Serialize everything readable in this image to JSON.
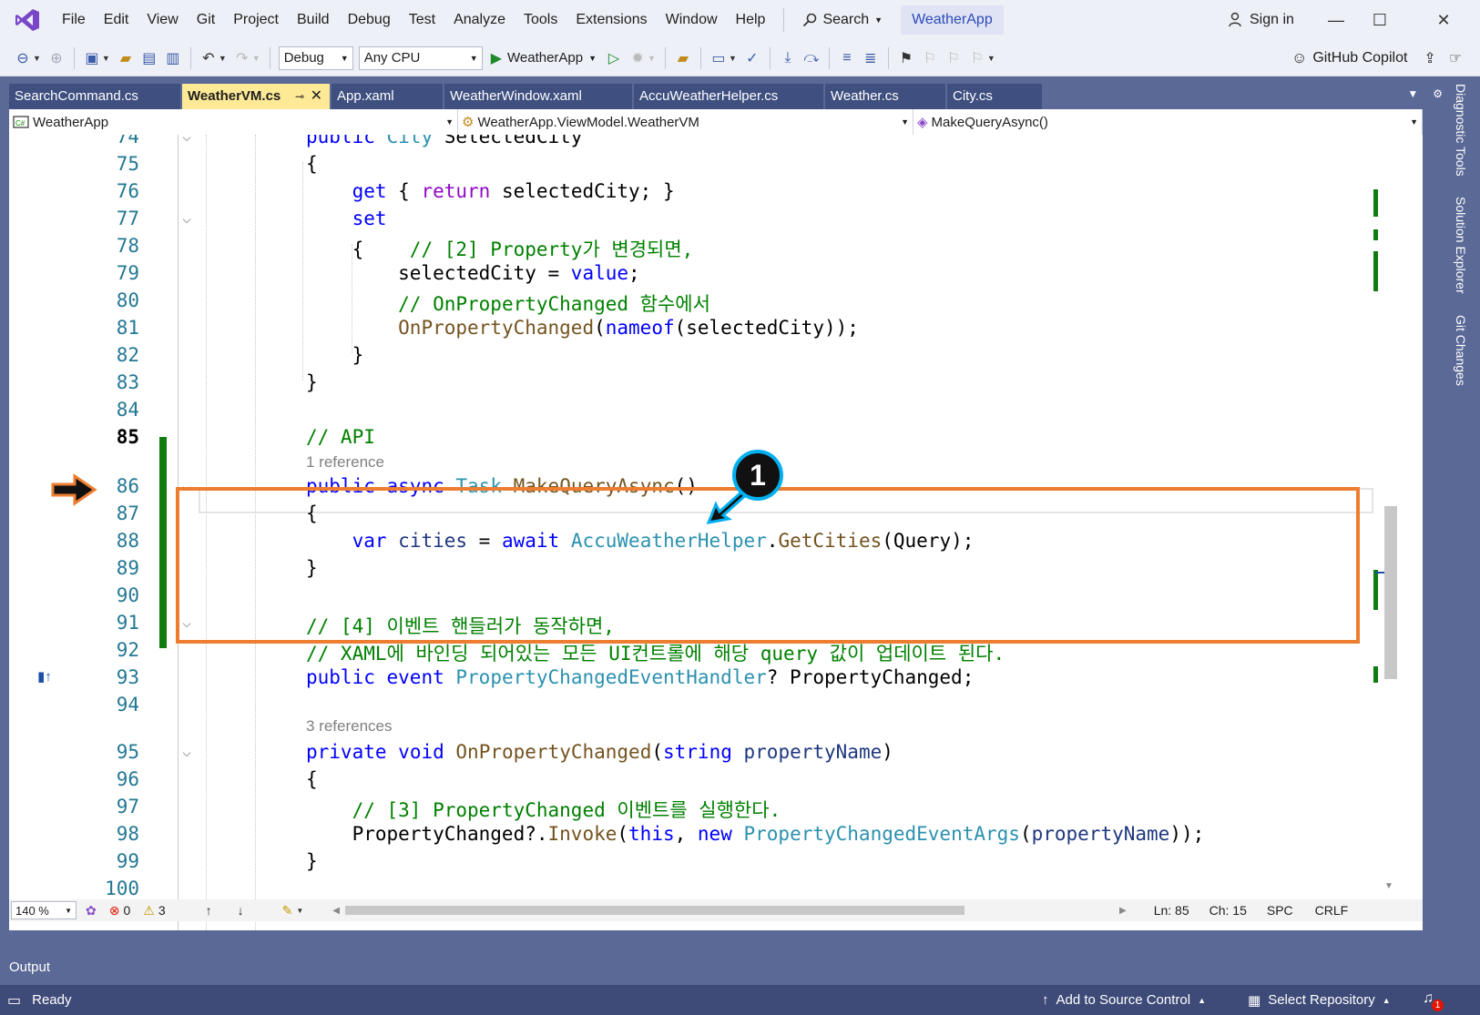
{
  "menu": {
    "items": [
      "File",
      "Edit",
      "View",
      "Git",
      "Project",
      "Build",
      "Debug",
      "Test",
      "Analyze",
      "Tools",
      "Extensions",
      "Window",
      "Help"
    ],
    "search_label": "Search",
    "solution_name": "WeatherApp",
    "sign_in": "Sign in"
  },
  "toolbar": {
    "config": "Debug",
    "platform": "Any CPU",
    "run_target": "WeatherApp",
    "copilot": "GitHub Copilot"
  },
  "tabs": [
    {
      "label": "SearchCommand.cs",
      "active": false
    },
    {
      "label": "WeatherVM.cs",
      "active": true
    },
    {
      "label": "App.xaml",
      "active": false
    },
    {
      "label": "WeatherWindow.xaml",
      "active": false
    },
    {
      "label": "AccuWeatherHelper.cs",
      "active": false
    },
    {
      "label": "Weather.cs",
      "active": false
    },
    {
      "label": "City.cs",
      "active": false
    }
  ],
  "navbar": {
    "project": "WeatherApp",
    "type": "WeatherApp.ViewModel.WeatherVM",
    "member": "MakeQueryAsync()"
  },
  "editor": {
    "line_numbers": [
      "74",
      "75",
      "76",
      "77",
      "78",
      "79",
      "80",
      "81",
      "82",
      "83",
      "84",
      "85",
      "86",
      "87",
      "88",
      "89",
      "90",
      "91",
      "92",
      "93",
      "94",
      "95",
      "96",
      "97",
      "98",
      "99",
      "100"
    ],
    "current_line": "85",
    "codelens_1": "1 reference",
    "codelens_2": "3 references",
    "annotation_badge": "1"
  },
  "status_strip": {
    "zoom": "140 %",
    "errors": "0",
    "warnings": "3",
    "line": "Ln: 85",
    "col": "Ch: 15",
    "whitespace": "SPC",
    "line_ending": "CRLF"
  },
  "dock": {
    "items": [
      "Diagnostic Tools",
      "Solution Explorer",
      "Git Changes"
    ]
  },
  "output_label": "Output",
  "statusbar": {
    "ready": "Ready",
    "add_source": "Add to Source Control",
    "select_repo": "Select Repository",
    "notification_count": "1"
  },
  "colors": {
    "highlight_box": "#ed7d31",
    "badge_ring": "#00b0f0",
    "active_tab": "#fde996",
    "frame": "#5a6996"
  }
}
